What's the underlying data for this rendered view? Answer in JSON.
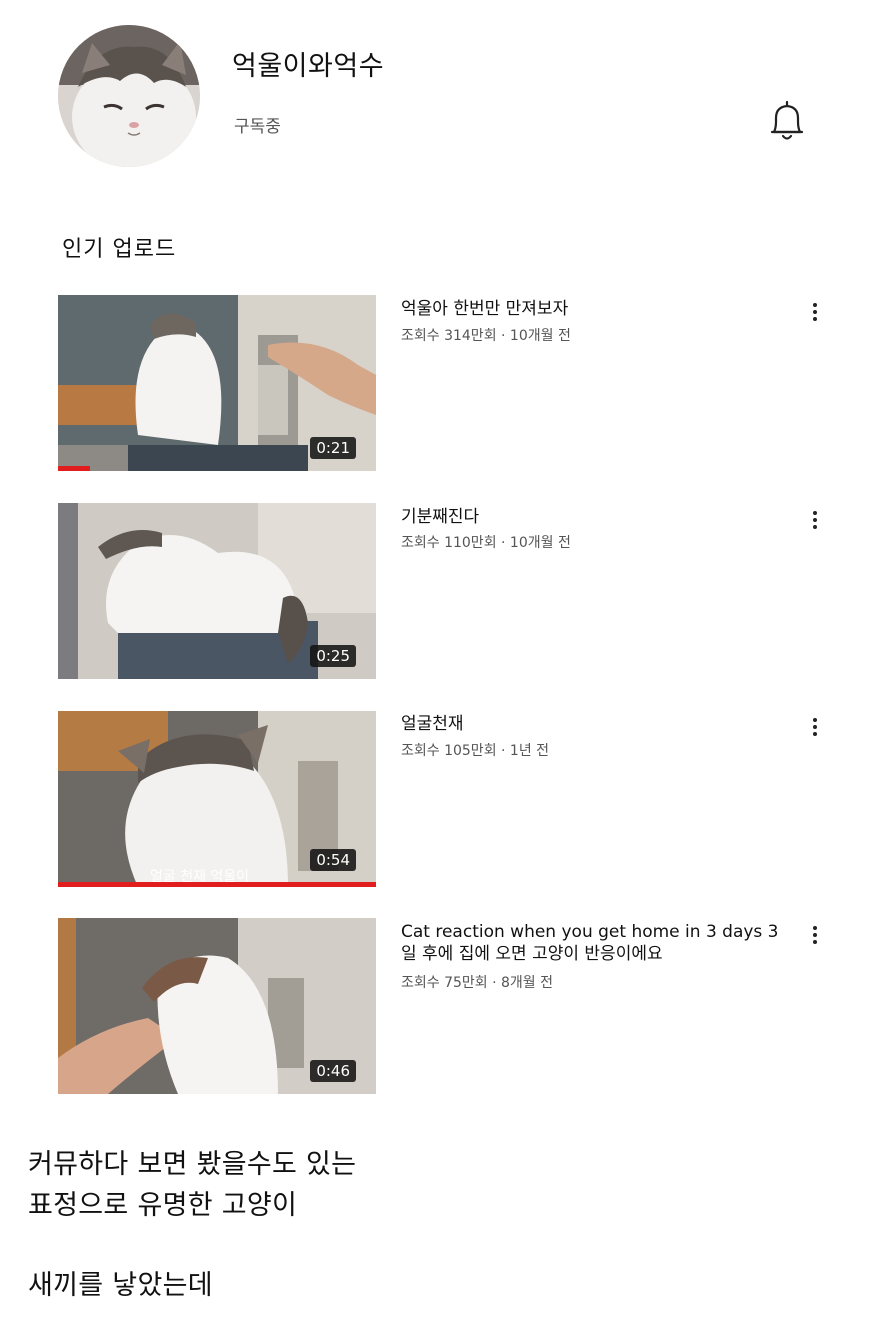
{
  "channel": {
    "name": "억울이와억수",
    "subscription_status": "구독중"
  },
  "section_title": "인기 업로드",
  "videos": [
    {
      "title": "억울아 한번만 만져보자",
      "views": "조회수 314만회",
      "age": "10개월 전",
      "meta": "조회수 314만회 · 10개월 전",
      "duration": "0:21",
      "watch_progress": 0.1
    },
    {
      "title": "기분째진다",
      "views": "조회수 110만회",
      "age": "10개월 전",
      "meta": "조회수 110만회 · 10개월 전",
      "duration": "0:25",
      "watch_progress": 0
    },
    {
      "title": "얼굴천재",
      "views": "조회수 105만회",
      "age": "1년 전",
      "meta": "조회수 105만회 · 1년 전",
      "duration": "0:54",
      "watch_progress": 1.0,
      "thumbnail_caption": "얼굴 천재 억울이"
    },
    {
      "title": "Cat reaction when you get home in 3 days 3일 후에 집에 오면 고양이 반응이에요",
      "views": "조회수 75만회",
      "age": "8개월 전",
      "meta": "조회수 75만회 · 8개월 전",
      "duration": "0:46",
      "watch_progress": 0
    }
  ],
  "caption": {
    "line1": "커뮤하다 보면 봤을수도 있는",
    "line2": "표정으로 유명한 고양이",
    "line3": "새끼를 낳았는데"
  },
  "colors": {
    "progress": "#e11d1d",
    "text_primary": "#111111",
    "text_secondary": "#555555"
  },
  "icons": [
    "bell-icon",
    "more-vert-icon"
  ]
}
